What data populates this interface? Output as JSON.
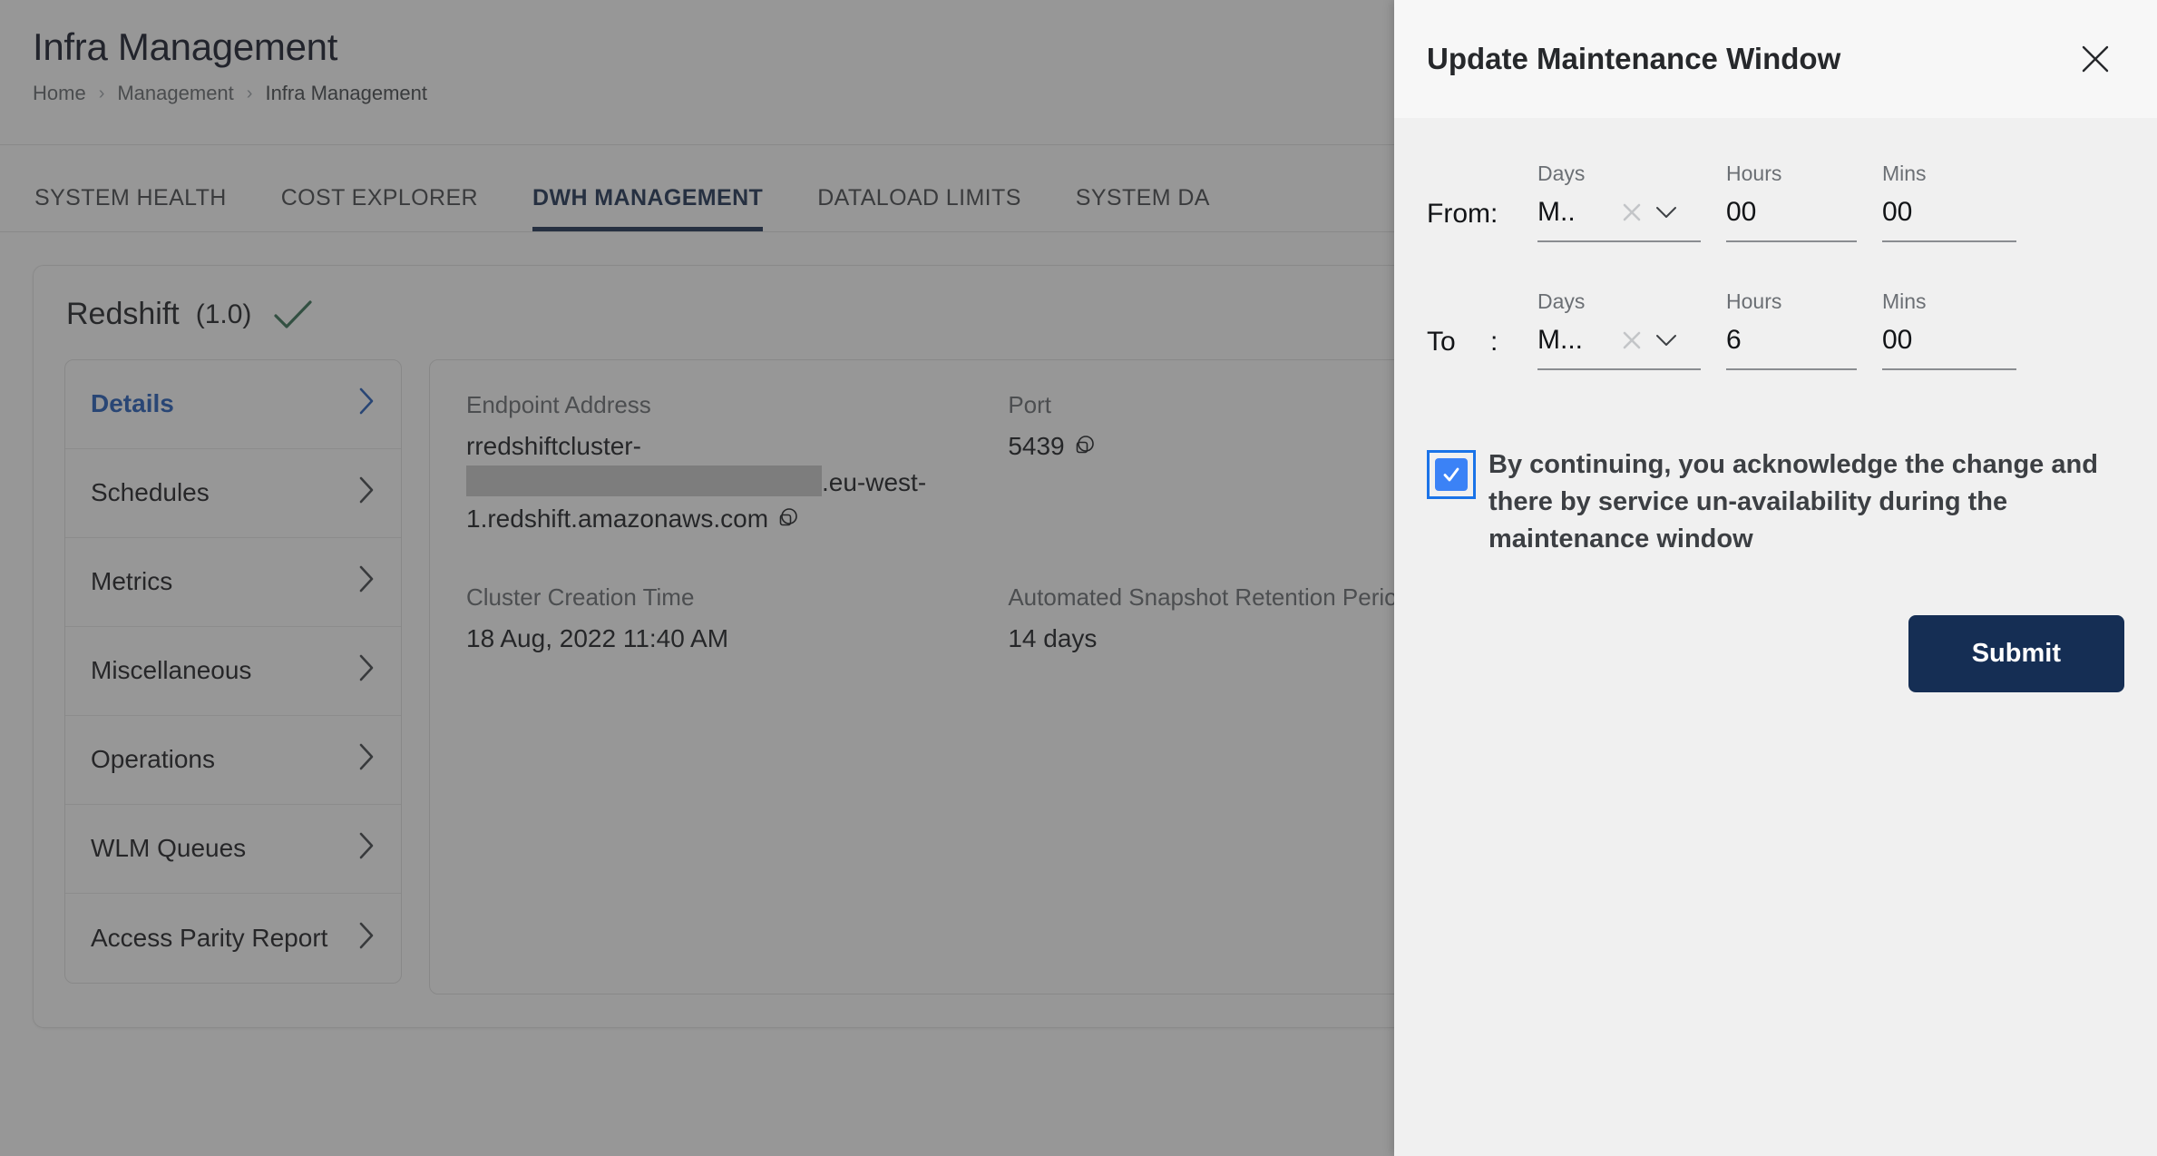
{
  "page": {
    "title": "Infra Management",
    "breadcrumb": [
      "Home",
      "Management",
      "Infra Management"
    ],
    "breadcrumb_separator": "›",
    "tabs": [
      {
        "label": "SYSTEM HEALTH",
        "active": false
      },
      {
        "label": "COST EXPLORER",
        "active": false
      },
      {
        "label": "DWH MANAGEMENT",
        "active": true
      },
      {
        "label": "DATALOAD LIMITS",
        "active": false
      },
      {
        "label": "SYSTEM DA",
        "active": false
      }
    ],
    "accent_color": "#13294b",
    "link_color": "#1a56b8"
  },
  "service": {
    "name": "Redshift",
    "version": "(1.0)",
    "status_icon": "check-icon",
    "status_color": "#2f6b4f"
  },
  "side_menu": {
    "items": [
      {
        "label": "Details",
        "active": true
      },
      {
        "label": "Schedules",
        "active": false
      },
      {
        "label": "Metrics",
        "active": false
      },
      {
        "label": "Miscellaneous",
        "active": false
      },
      {
        "label": "Operations",
        "active": false
      },
      {
        "label": "WLM Queues",
        "active": false
      },
      {
        "label": "Access Parity Report",
        "active": false
      }
    ]
  },
  "details": [
    {
      "label": "Endpoint Address",
      "value_before": "rredshiftcluster-",
      "redacted": true,
      "value_after": ".eu-west-1.redshift.amazonaws.com",
      "copy": true
    },
    {
      "label": "Port",
      "value": "5439",
      "copy": true
    },
    {
      "label": "",
      "value": ""
    },
    {
      "label": "Cluster Creation Time",
      "value": "18 Aug, 2022 11:40 AM",
      "copy": false
    },
    {
      "label": "Automated Snapshot Retention Period",
      "value": "14 days",
      "copy": false
    },
    {
      "label": "",
      "value": ""
    }
  ],
  "modal": {
    "title": "Update Maintenance Window",
    "close_icon": "close-icon",
    "rows": [
      {
        "label": "From",
        "colon": ":",
        "days_label": "Days",
        "days_value": "M..",
        "clear_icon": "clear-x-icon",
        "chevron_icon": "chevron-down-icon",
        "hours_label": "Hours",
        "hours_value": "00",
        "mins_label": "Mins",
        "mins_value": "00"
      },
      {
        "label": "To",
        "colon": ":",
        "days_label": "Days",
        "days_value": "M...",
        "clear_icon": "clear-x-icon",
        "chevron_icon": "chevron-down-icon",
        "hours_label": "Hours",
        "hours_value": "6",
        "mins_label": "Mins",
        "mins_value": "00"
      }
    ],
    "acknowledgement": {
      "checked": true,
      "text": "By continuing, you acknowledge the change and there by service un-availability during the maintenance window"
    },
    "submit_label": "Submit",
    "submit_color": "#152e54",
    "checkbox_color": "#3b82f6",
    "focus_ring_color": "#1a73e8"
  }
}
